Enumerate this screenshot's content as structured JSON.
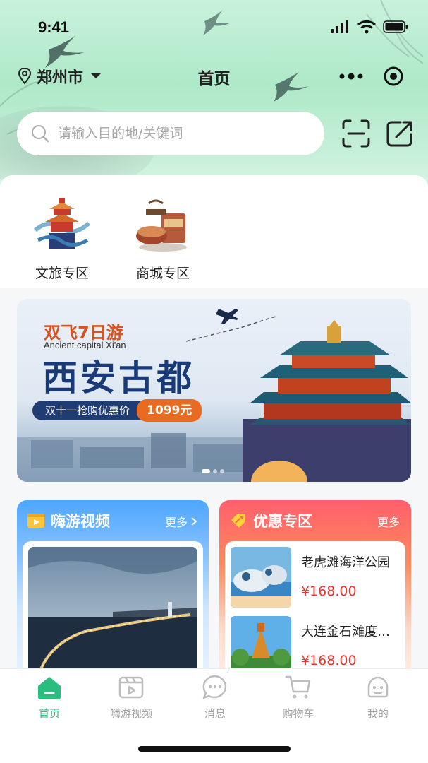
{
  "status": {
    "time": "9:41"
  },
  "nav": {
    "city": "郑州市",
    "title": "首页"
  },
  "search": {
    "placeholder": "请输入目的地/关键词"
  },
  "quick_links": [
    {
      "label": "文旅专区",
      "icon": "palace-icon"
    },
    {
      "label": "商城专区",
      "icon": "mall-icon"
    }
  ],
  "banner": {
    "tag": "双飞7日游",
    "subtitle": "Ancient capital Xi'an",
    "title": "西安古都",
    "promo": "双十一抢购优惠价",
    "price": "1099元"
  },
  "video_card": {
    "title": "嗨游视频",
    "more": "更多"
  },
  "deal_card": {
    "title": "优惠专区",
    "more": "更多",
    "items": [
      {
        "name": "老虎滩海洋公园",
        "price": "¥168.00"
      },
      {
        "name": "大连金石滩度假区",
        "price": "¥168.00"
      }
    ]
  },
  "tabbar": [
    {
      "label": "首页",
      "icon": "home-icon",
      "active": true
    },
    {
      "label": "嗨游视频",
      "icon": "video-icon"
    },
    {
      "label": "消息",
      "icon": "message-icon"
    },
    {
      "label": "购物车",
      "icon": "cart-icon"
    },
    {
      "label": "我的",
      "icon": "profile-icon"
    }
  ],
  "colors": {
    "accent": "#2bbd7e",
    "price": "#e8352d",
    "banner_title": "#183a76"
  }
}
